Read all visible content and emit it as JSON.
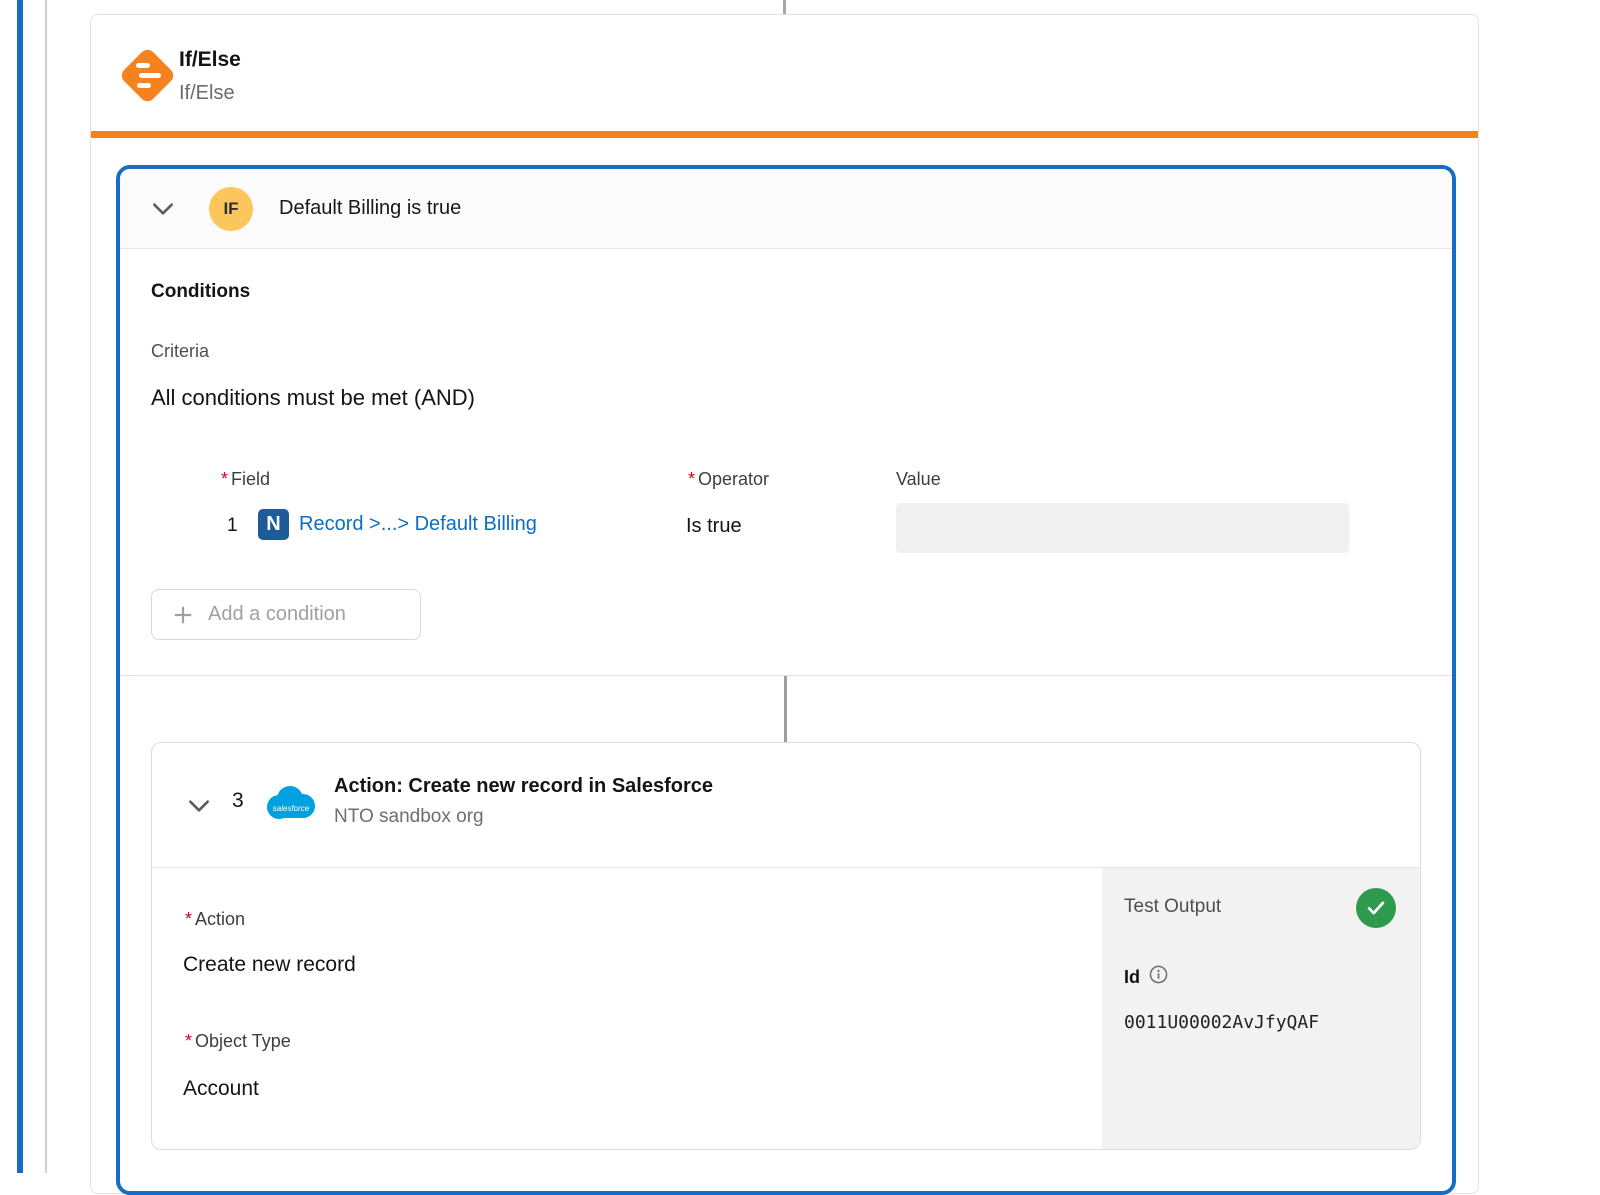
{
  "ui": {
    "required_marker": "*"
  },
  "icons": {
    "netsuite_glyph": "N",
    "salesforce_wordmark": "salesforce"
  },
  "ifelse": {
    "title": "If/Else",
    "subtitle": "If/Else"
  },
  "if_branch": {
    "badge": "IF",
    "label": "Default Billing is true",
    "conditions": {
      "heading": "Conditions",
      "criteria_label": "Criteria",
      "criteria_value": "All conditions must be met (AND)",
      "columns": {
        "field": "Field",
        "operator": "Operator",
        "value": "Value"
      },
      "rows": [
        {
          "index": "1",
          "field": "Record >...> Default Billing",
          "operator": "Is true",
          "value": ""
        }
      ],
      "add_button_label": "Add a condition"
    }
  },
  "action": {
    "index": "3",
    "title": "Action: Create new record in Salesforce",
    "subtitle": "NTO sandbox org",
    "fields": [
      {
        "label": "Action",
        "value": "Create new record"
      },
      {
        "label": "Object Type",
        "value": "Account"
      }
    ],
    "test_output": {
      "title": "Test Output",
      "id_label": "Id",
      "id_value": "0011U00002AvJfyQAF"
    }
  },
  "colors": {
    "accent_orange": "#F5821F",
    "selection_blue": "#186CC4",
    "link_blue": "#0D6DC5",
    "badge_yellow": "#FBC75D",
    "success_green": "#2E9A4D",
    "salesforce_blue": "#00A1E0"
  }
}
